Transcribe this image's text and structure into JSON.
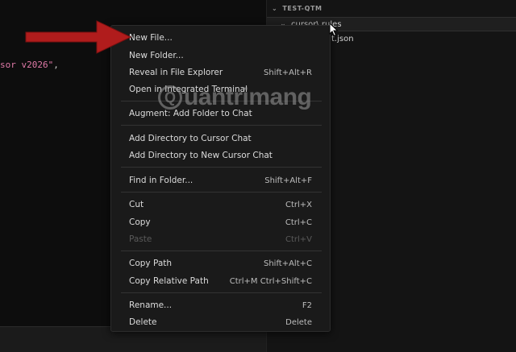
{
  "editor": {
    "code_string": "sor v2026\"",
    "code_punct": ","
  },
  "explorer": {
    "workspace_title": "TEST-QTM",
    "folder_row": "cursor\\ rules",
    "file_row": "t.json"
  },
  "menu": {
    "items": [
      {
        "label": "New File...",
        "shortcut": ""
      },
      {
        "label": "New Folder...",
        "shortcut": ""
      },
      {
        "label": "Reveal in File Explorer",
        "shortcut": "Shift+Alt+R"
      },
      {
        "label": "Open in Integrated Terminal",
        "shortcut": ""
      },
      {
        "label": "Augment: Add Folder to Chat",
        "shortcut": ""
      },
      {
        "label": "Add Directory to Cursor Chat",
        "shortcut": ""
      },
      {
        "label": "Add Directory to New Cursor Chat",
        "shortcut": ""
      },
      {
        "label": "Find in Folder...",
        "shortcut": "Shift+Alt+F"
      },
      {
        "label": "Cut",
        "shortcut": "Ctrl+X"
      },
      {
        "label": "Copy",
        "shortcut": "Ctrl+C"
      },
      {
        "label": "Paste",
        "shortcut": "Ctrl+V"
      },
      {
        "label": "Copy Path",
        "shortcut": "Shift+Alt+C"
      },
      {
        "label": "Copy Relative Path",
        "shortcut": "Ctrl+M Ctrl+Shift+C"
      },
      {
        "label": "Rename...",
        "shortcut": "F2"
      },
      {
        "label": "Delete",
        "shortcut": "Delete"
      }
    ]
  },
  "watermark": {
    "letter": "Q",
    "text": "uantrimang"
  },
  "colors": {
    "arrow": "#b01c1c",
    "menu_bg": "#1a1a1a",
    "string": "#e07aa8"
  }
}
